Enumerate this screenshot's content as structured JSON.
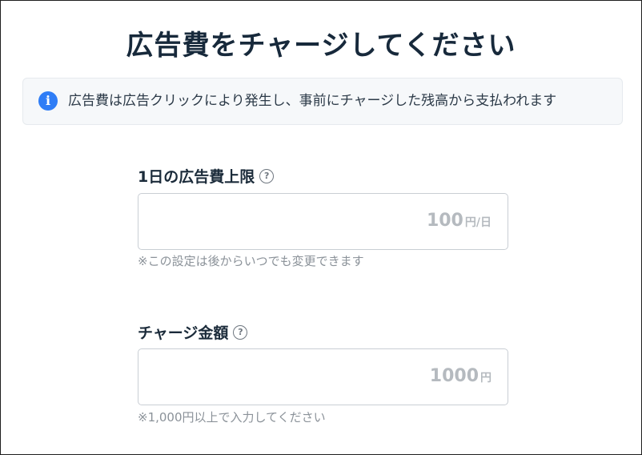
{
  "page": {
    "title": "広告費をチャージしてください"
  },
  "notice": {
    "icon": "info-icon",
    "icon_glyph": "i",
    "text": "広告費は広告クリックにより発生し、事前にチャージした残高から支払われます",
    "accent_color": "#2f7df6"
  },
  "daily_limit": {
    "label": "1日の広告費上限",
    "help_icon": "help-icon",
    "help_glyph": "?",
    "placeholder_value": "100",
    "unit": "円/日",
    "hint": "※この設定は後からいつでも変更できます"
  },
  "charge_amount": {
    "label": "チャージ金額",
    "help_icon": "help-icon",
    "help_glyph": "?",
    "placeholder_value": "1000",
    "unit": "円",
    "hint": "※1,000円以上で入力してください"
  }
}
